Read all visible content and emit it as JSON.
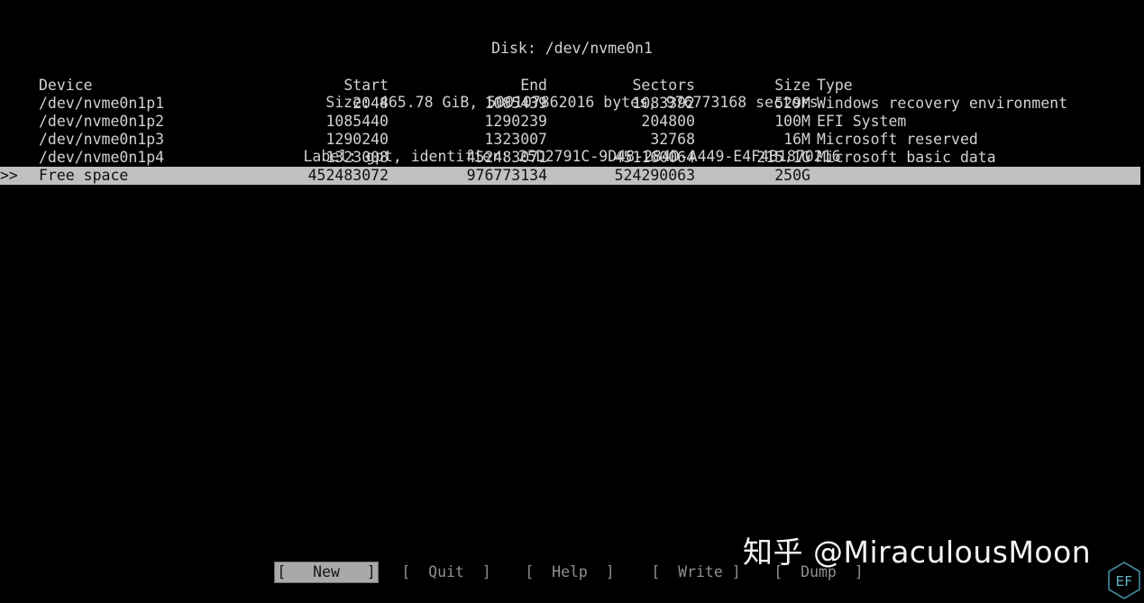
{
  "app": {
    "name": "cfdisk",
    "bg_color": "#000000",
    "fg_color": "#d2d2d2",
    "highlight_bg": "#c0c0c0",
    "highlight_fg": "#101010"
  },
  "header": {
    "disk_line": "Disk: /dev/nvme0n1",
    "size_line": "Size: 465.78 GiB, 500107862016 bytes, 976773168 sectors",
    "label_line": "Label: gpt, identifier: 25D2791C-9D48-284D-A449-E4F4B1870216"
  },
  "table": {
    "columns": [
      "Device",
      "Start",
      "End",
      "Sectors",
      "Size",
      "Type"
    ],
    "rows": [
      {
        "marker": "",
        "device": "/dev/nvme0n1p1",
        "start": "2048",
        "end": "1085439",
        "sectors": "1083392",
        "size": "529M",
        "type": "Windows recovery environment",
        "selected": false
      },
      {
        "marker": "",
        "device": "/dev/nvme0n1p2",
        "start": "1085440",
        "end": "1290239",
        "sectors": "204800",
        "size": "100M",
        "type": "EFI System",
        "selected": false
      },
      {
        "marker": "",
        "device": "/dev/nvme0n1p3",
        "start": "1290240",
        "end": "1323007",
        "sectors": "32768",
        "size": "16M",
        "type": "Microsoft reserved",
        "selected": false
      },
      {
        "marker": "",
        "device": "/dev/nvme0n1p4",
        "start": "1323008",
        "end": "452483071",
        "sectors": "451160064",
        "size": "215.1G",
        "type": "Microsoft basic data",
        "selected": false
      },
      {
        "marker": ">>",
        "device": "Free space",
        "start": "452483072",
        "end": "976773134",
        "sectors": "524290063",
        "size": "250G",
        "type": "",
        "selected": true
      }
    ]
  },
  "buttons": [
    {
      "label": "New",
      "text": "[   New   ]",
      "active": true
    },
    {
      "label": "Quit",
      "text": "[  Quit  ]",
      "active": false
    },
    {
      "label": "Help",
      "text": "[  Help  ]",
      "active": false
    },
    {
      "label": "Write",
      "text": "[  Write ]",
      "active": false
    },
    {
      "label": "Dump",
      "text": "[  Dump  ]",
      "active": false
    }
  ],
  "watermark": {
    "text": "知乎 @MiraculousMoon",
    "logo_text": "EF",
    "logo_color": "#3f8d9c"
  }
}
